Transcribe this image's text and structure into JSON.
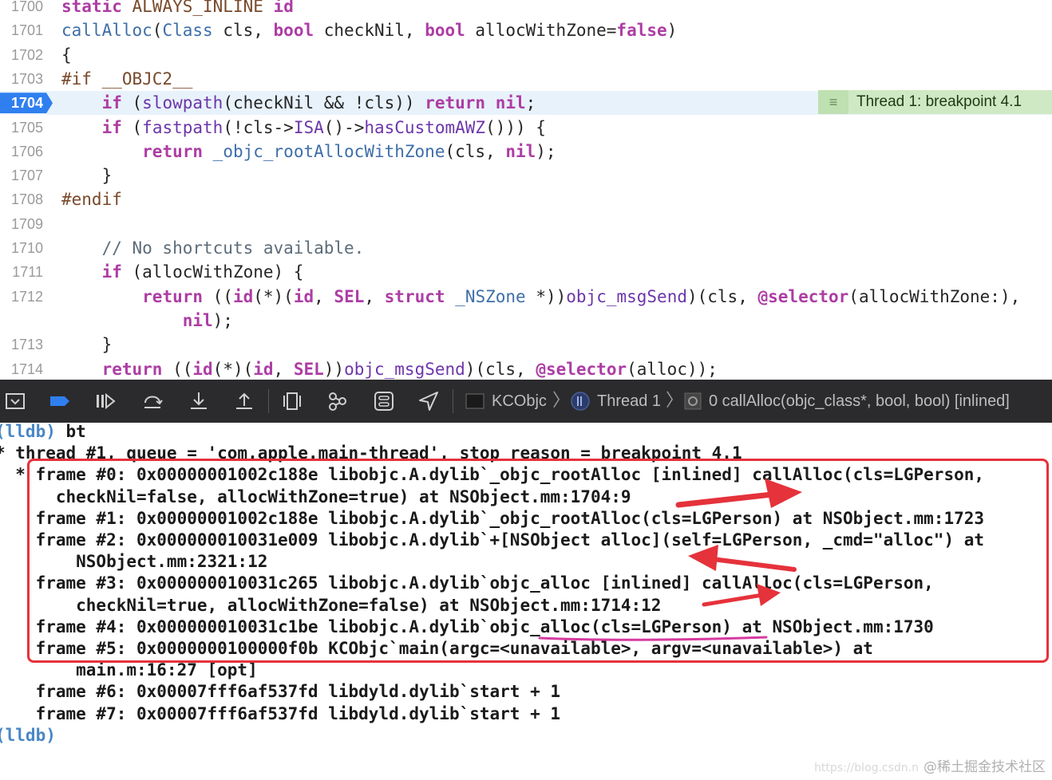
{
  "editor": {
    "lines": [
      {
        "num": "1700",
        "segs": [
          {
            "c": "kw",
            "t": "static"
          },
          {
            "c": "plain",
            "t": " "
          },
          {
            "c": "pp",
            "t": "ALWAYS_INLINE"
          },
          {
            "c": "plain",
            "t": " "
          },
          {
            "c": "kw",
            "t": "id"
          }
        ]
      },
      {
        "num": "1701",
        "segs": [
          {
            "c": "fn",
            "t": "callAlloc"
          },
          {
            "c": "plain",
            "t": "("
          },
          {
            "c": "fn",
            "t": "Class"
          },
          {
            "c": "plain",
            "t": " cls, "
          },
          {
            "c": "kw",
            "t": "bool"
          },
          {
            "c": "plain",
            "t": " checkNil, "
          },
          {
            "c": "kw",
            "t": "bool"
          },
          {
            "c": "plain",
            "t": " allocWithZone="
          },
          {
            "c": "kw",
            "t": "false"
          },
          {
            "c": "plain",
            "t": ")"
          }
        ]
      },
      {
        "num": "1702",
        "segs": [
          {
            "c": "plain",
            "t": "{"
          }
        ]
      },
      {
        "num": "1703",
        "segs": [
          {
            "c": "pp",
            "t": "#if __OBJC2__"
          }
        ]
      },
      {
        "num": "1704",
        "active": true,
        "segs": [
          {
            "c": "plain",
            "t": "    "
          },
          {
            "c": "kw",
            "t": "if"
          },
          {
            "c": "plain",
            "t": " ("
          },
          {
            "c": "fn2",
            "t": "slowpath"
          },
          {
            "c": "plain",
            "t": "(checkNil && !cls)) "
          },
          {
            "c": "kw",
            "t": "return"
          },
          {
            "c": "plain",
            "t": " "
          },
          {
            "c": "kw",
            "t": "nil"
          },
          {
            "c": "plain",
            "t": ";"
          }
        ]
      },
      {
        "num": "1705",
        "segs": [
          {
            "c": "plain",
            "t": "    "
          },
          {
            "c": "kw",
            "t": "if"
          },
          {
            "c": "plain",
            "t": " ("
          },
          {
            "c": "fn2",
            "t": "fastpath"
          },
          {
            "c": "plain",
            "t": "(!cls->"
          },
          {
            "c": "fn2",
            "t": "ISA"
          },
          {
            "c": "plain",
            "t": "()->"
          },
          {
            "c": "fn2",
            "t": "hasCustomAWZ"
          },
          {
            "c": "plain",
            "t": "())) {"
          }
        ]
      },
      {
        "num": "1706",
        "segs": [
          {
            "c": "plain",
            "t": "        "
          },
          {
            "c": "kw",
            "t": "return"
          },
          {
            "c": "plain",
            "t": " "
          },
          {
            "c": "fn",
            "t": "_objc_rootAllocWithZone"
          },
          {
            "c": "plain",
            "t": "(cls, "
          },
          {
            "c": "kw",
            "t": "nil"
          },
          {
            "c": "plain",
            "t": ");"
          }
        ]
      },
      {
        "num": "1707",
        "segs": [
          {
            "c": "plain",
            "t": "    }"
          }
        ]
      },
      {
        "num": "1708",
        "segs": [
          {
            "c": "pp",
            "t": "#endif"
          }
        ]
      },
      {
        "num": "1709",
        "segs": []
      },
      {
        "num": "1710",
        "segs": [
          {
            "c": "plain",
            "t": "    "
          },
          {
            "c": "cm",
            "t": "// No shortcuts available."
          }
        ]
      },
      {
        "num": "1711",
        "segs": [
          {
            "c": "plain",
            "t": "    "
          },
          {
            "c": "kw",
            "t": "if"
          },
          {
            "c": "plain",
            "t": " (allocWithZone) {"
          }
        ]
      },
      {
        "num": "1712",
        "segs": [
          {
            "c": "plain",
            "t": "        "
          },
          {
            "c": "kw",
            "t": "return"
          },
          {
            "c": "plain",
            "t": " (("
          },
          {
            "c": "kw",
            "t": "id"
          },
          {
            "c": "plain",
            "t": "(*)("
          },
          {
            "c": "kw",
            "t": "id"
          },
          {
            "c": "plain",
            "t": ", "
          },
          {
            "c": "kw",
            "t": "SEL"
          },
          {
            "c": "plain",
            "t": ", "
          },
          {
            "c": "kw",
            "t": "struct"
          },
          {
            "c": "plain",
            "t": " "
          },
          {
            "c": "fn",
            "t": "_NSZone"
          },
          {
            "c": "plain",
            "t": " *))"
          },
          {
            "c": "fn2",
            "t": "objc_msgSend"
          },
          {
            "c": "plain",
            "t": ")(cls, "
          },
          {
            "c": "kw",
            "t": "@selector"
          },
          {
            "c": "plain",
            "t": "(allocWithZone:),"
          }
        ]
      },
      {
        "num": "",
        "segs": [
          {
            "c": "plain",
            "t": "            "
          },
          {
            "c": "kw",
            "t": "nil"
          },
          {
            "c": "plain",
            "t": ");"
          }
        ]
      },
      {
        "num": "1713",
        "segs": [
          {
            "c": "plain",
            "t": "    }"
          }
        ]
      },
      {
        "num": "1714",
        "segs": [
          {
            "c": "plain",
            "t": "    "
          },
          {
            "c": "kw",
            "t": "return"
          },
          {
            "c": "plain",
            "t": " (("
          },
          {
            "c": "kw",
            "t": "id"
          },
          {
            "c": "plain",
            "t": "(*)("
          },
          {
            "c": "kw",
            "t": "id"
          },
          {
            "c": "plain",
            "t": ", "
          },
          {
            "c": "kw",
            "t": "SEL"
          },
          {
            "c": "plain",
            "t": "))"
          },
          {
            "c": "fn2",
            "t": "objc_msgSend"
          },
          {
            "c": "plain",
            "t": ")(cls, "
          },
          {
            "c": "kw",
            "t": "@selector"
          },
          {
            "c": "plain",
            "t": "(alloc));"
          }
        ]
      }
    ],
    "breakpoint_annotation": "Thread 1: breakpoint 4.1"
  },
  "debugbar": {
    "breadcrumb": {
      "target": "KCObjc",
      "thread": "Thread 1",
      "frame": "0 callAlloc(objc_class*, bool, bool) [inlined]"
    },
    "buttons": [
      "hide-console-icon",
      "breakpoints-toggle-icon",
      "continue-icon",
      "step-over-icon",
      "step-into-icon",
      "step-out-icon",
      "view-hierarchy-icon",
      "memory-graph-icon",
      "environment-overrides-icon",
      "location-icon"
    ]
  },
  "console": {
    "lines": [
      {
        "prompt": "(lldb)",
        "text": " bt"
      },
      {
        "text": "* thread #1, queue = 'com.apple.main-thread', stop reason = breakpoint 4.1"
      },
      {
        "text": "  * frame #0: 0x00000001002c188e libobjc.A.dylib`_objc_rootAlloc [inlined] callAlloc(cls=LGPerson,"
      },
      {
        "text": "      checkNil=false, allocWithZone=true) at NSObject.mm:1704:9"
      },
      {
        "text": "    frame #1: 0x00000001002c188e libobjc.A.dylib`_objc_rootAlloc(cls=LGPerson) at NSObject.mm:1723"
      },
      {
        "text": "    frame #2: 0x000000010031e009 libobjc.A.dylib`+[NSObject alloc](self=LGPerson, _cmd=\"alloc\") at"
      },
      {
        "text": "        NSObject.mm:2321:12"
      },
      {
        "text": "    frame #3: 0x000000010031c265 libobjc.A.dylib`objc_alloc [inlined] callAlloc(cls=LGPerson,"
      },
      {
        "text": "        checkNil=true, allocWithZone=false) at NSObject.mm:1714:12"
      },
      {
        "text": "    frame #4: 0x000000010031c1be libobjc.A.dylib`objc_alloc(cls=LGPerson) at NSObject.mm:1730"
      },
      {
        "text": "    frame #5: 0x0000000100000f0b KCObjc`main(argc=<unavailable>, argv=<unavailable>) at"
      },
      {
        "text": "        main.m:16:27 [opt]"
      },
      {
        "text": "    frame #6: 0x00007fff6af537fd libdyld.dylib`start + 1"
      },
      {
        "text": "    frame #7: 0x00007fff6af537fd libdyld.dylib`start + 1"
      },
      {
        "prompt": "(lldb)",
        "text": ""
      }
    ]
  },
  "watermark": {
    "url": "https://blog.csdn.n",
    "site": "@稀土掘金技术社区"
  },
  "colors": {
    "annotation_red": "#e5323b",
    "underline_pink": "#d63aa0",
    "active_line_badge": "#2f7ff0",
    "breakpoint_annotation_bg": "#cfe9c4",
    "debug_bar_bg": "#2b2b2d"
  }
}
